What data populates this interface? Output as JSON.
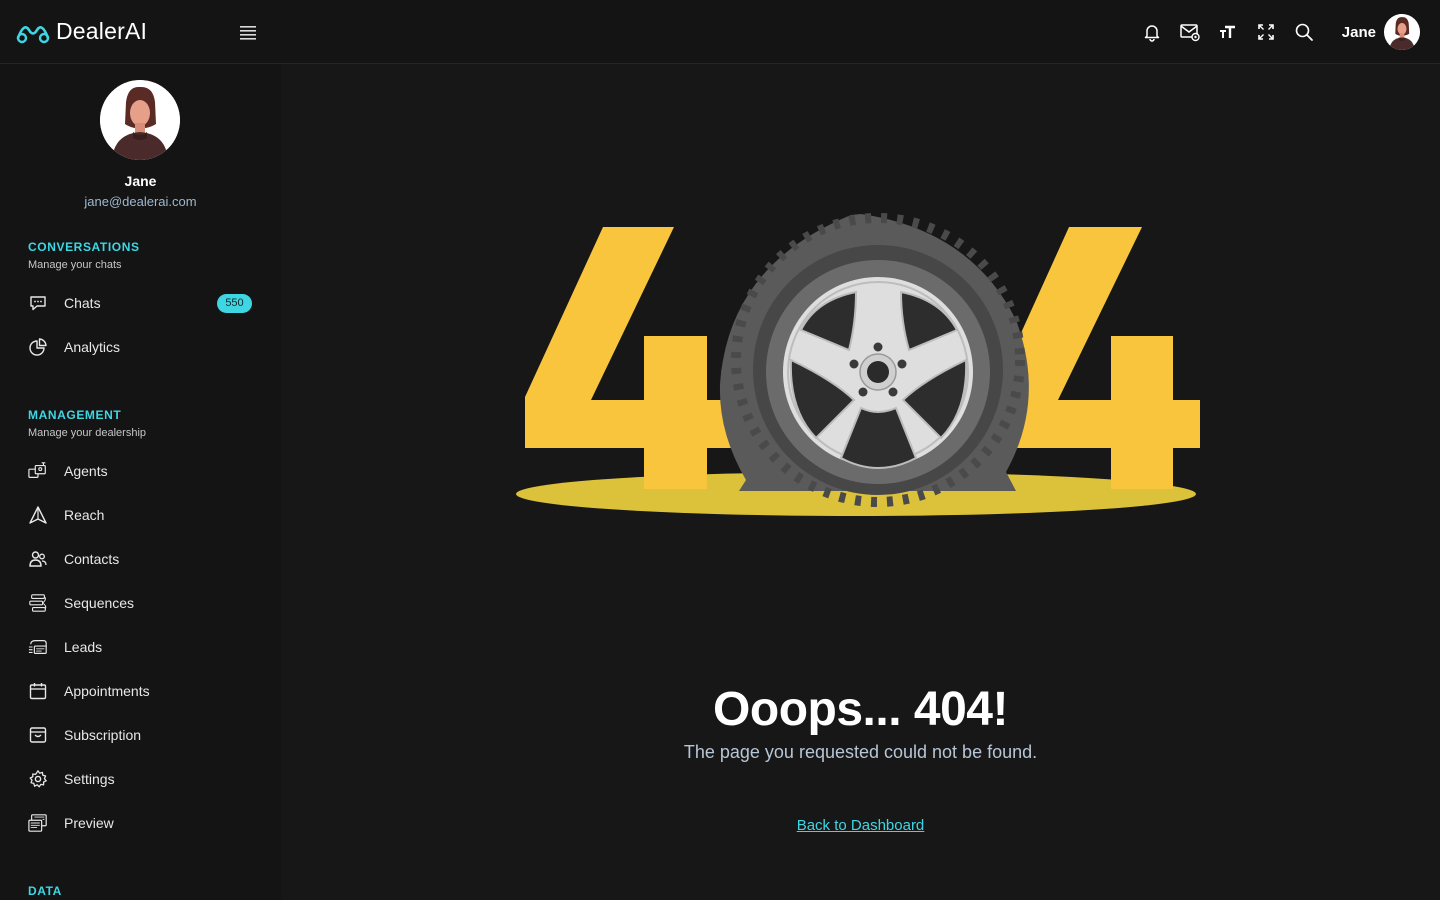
{
  "app": {
    "name": "DealerAI"
  },
  "topbar": {
    "user_name": "Jane"
  },
  "profile": {
    "name": "Jane",
    "email": "jane@dealerai.com"
  },
  "sections": {
    "conversations": {
      "title": "CONVERSATIONS",
      "subtitle": "Manage your chats"
    },
    "management": {
      "title": "MANAGEMENT",
      "subtitle": "Manage your dealership"
    },
    "data": {
      "title": "DATA"
    }
  },
  "nav": {
    "chats": {
      "label": "Chats",
      "badge": "550"
    },
    "analytics": {
      "label": "Analytics"
    },
    "agents": {
      "label": "Agents"
    },
    "reach": {
      "label": "Reach"
    },
    "contacts": {
      "label": "Contacts"
    },
    "sequences": {
      "label": "Sequences"
    },
    "leads": {
      "label": "Leads"
    },
    "appointments": {
      "label": "Appointments"
    },
    "subscription": {
      "label": "Subscription"
    },
    "settings": {
      "label": "Settings"
    },
    "preview": {
      "label": "Preview"
    }
  },
  "error": {
    "title": "Ooops... 404!",
    "message": "The page you requested could not be found.",
    "link_label": "Back to Dashboard"
  },
  "colors": {
    "accent": "#3fd6e4",
    "digit": "#f9c53d",
    "puddle": "#dcc23a",
    "background": "#171717"
  }
}
